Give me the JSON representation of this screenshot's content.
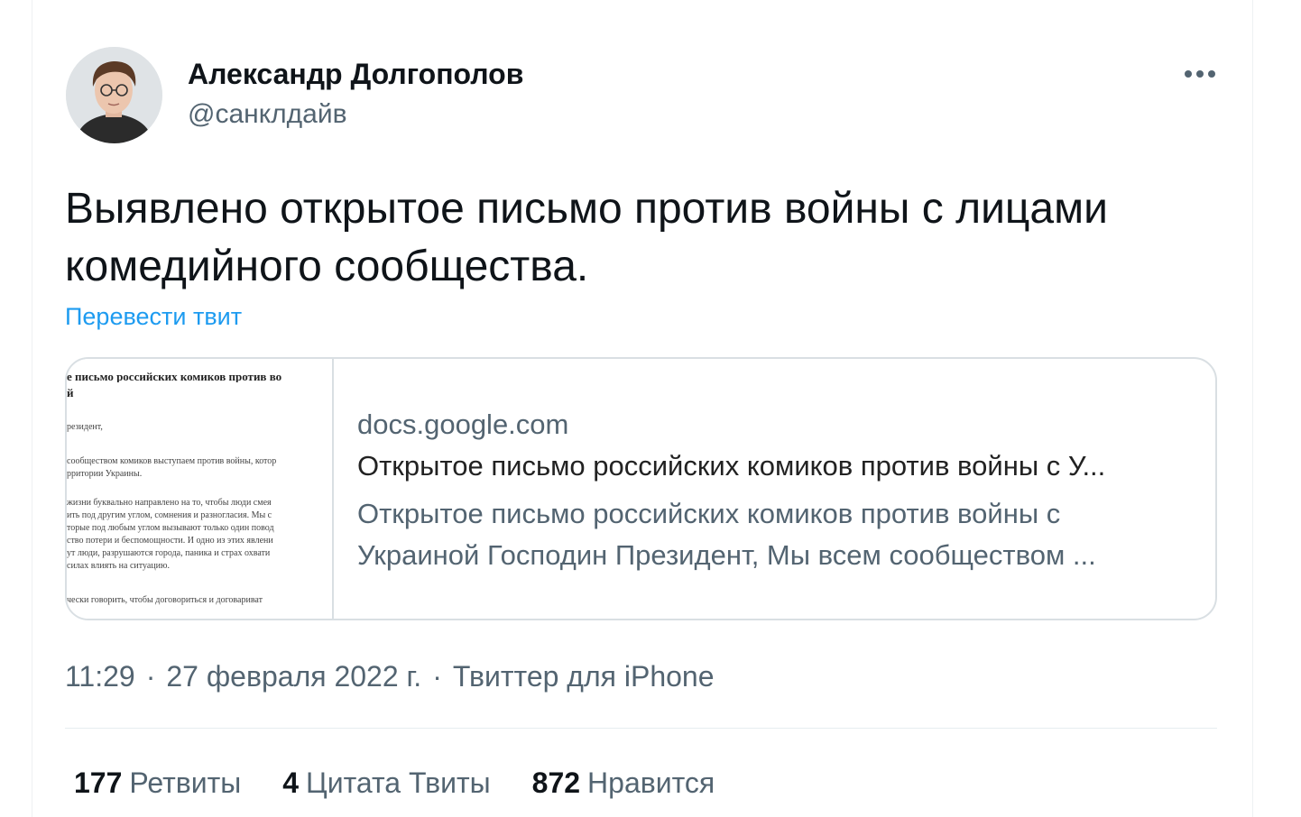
{
  "author": {
    "display_name": "Александр Долгополов",
    "handle": "@санклдайв"
  },
  "tweet": {
    "text": "Выявлено открытое письмо против войны с лицами комедийного сообщества.",
    "translate_label": "Перевести твит"
  },
  "card": {
    "domain": "docs.google.com",
    "title": "Открытое письмо российских комиков против войны с У...",
    "description": "Открытое письмо российских комиков против войны с Украиной Господин Президент, Мы всем сообществом ...",
    "thumbnail_lines": [
      "е письмо российских комиков против во",
      "й",
      "резидент,",
      "сообществом комиков выступаем против войны, котор",
      "рритории Украины.",
      "жизни буквально направлено на то, чтобы люди смея",
      "ить под другим углом, сомнения и разногласия. Мы с",
      "торые под любым углом вызывают только один повод",
      "ство потери и беспомощности. И одно из этих явлени",
      "ут люди, разрушаются города, паника и страх охвати",
      "силах влиять на ситуацию.",
      "чески говорить, чтобы договориться и договариват"
    ]
  },
  "meta": {
    "time": "11:29",
    "date": "27 февраля 2022 г.",
    "source": "Твиттер для iPhone"
  },
  "stats": {
    "retweets_count": "177",
    "retweets_label": "Ретвиты",
    "quotes_count": "4",
    "quotes_label": "Цитата Твиты",
    "likes_count": "872",
    "likes_label": "Нравится"
  },
  "icons": {
    "more": "more-dots-icon"
  },
  "colors": {
    "text_primary": "#0f1419",
    "text_secondary": "#536471",
    "link": "#1d9bf0",
    "border": "#d9dfe3"
  }
}
